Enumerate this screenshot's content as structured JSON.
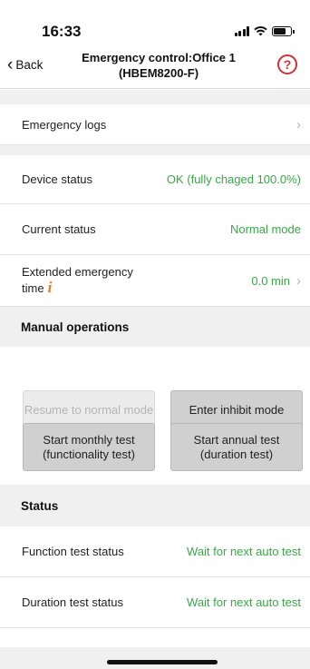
{
  "status_bar": {
    "time": "16:33"
  },
  "nav": {
    "back_label": "Back",
    "title": "Emergency control:Office 1 (HBEM8200-F)",
    "help_symbol": "?"
  },
  "emergency_logs": {
    "label": "Emergency logs",
    "arrow": "›"
  },
  "device_status": {
    "label": "Device status",
    "value": "OK (fully chaged 100.0%)"
  },
  "current_status": {
    "label": "Current status",
    "value": "Normal mode"
  },
  "extended_time": {
    "label_line1": "Extended emergency",
    "label_line2": "time",
    "info_symbol": "i",
    "value": "0.0 min",
    "arrow": "›"
  },
  "manual_operations": {
    "header": "Manual operations",
    "resume_button": "Resume to normal mode",
    "inhibit_button": "Enter inhibit mode",
    "monthly_line1": "Start monthly test",
    "monthly_line2": "(functionality test)",
    "annual_line1": "Start annual test",
    "annual_line2": "(duration test)"
  },
  "status_section": {
    "header": "Status",
    "function_test": {
      "label": "Function test status",
      "value": "Wait for next auto test"
    },
    "duration_test": {
      "label": "Duration test status",
      "value": "Wait for next auto test"
    }
  },
  "colors": {
    "status_green": "#3aa648",
    "help_red": "#d0303a",
    "info_orange": "#e57a1f"
  }
}
